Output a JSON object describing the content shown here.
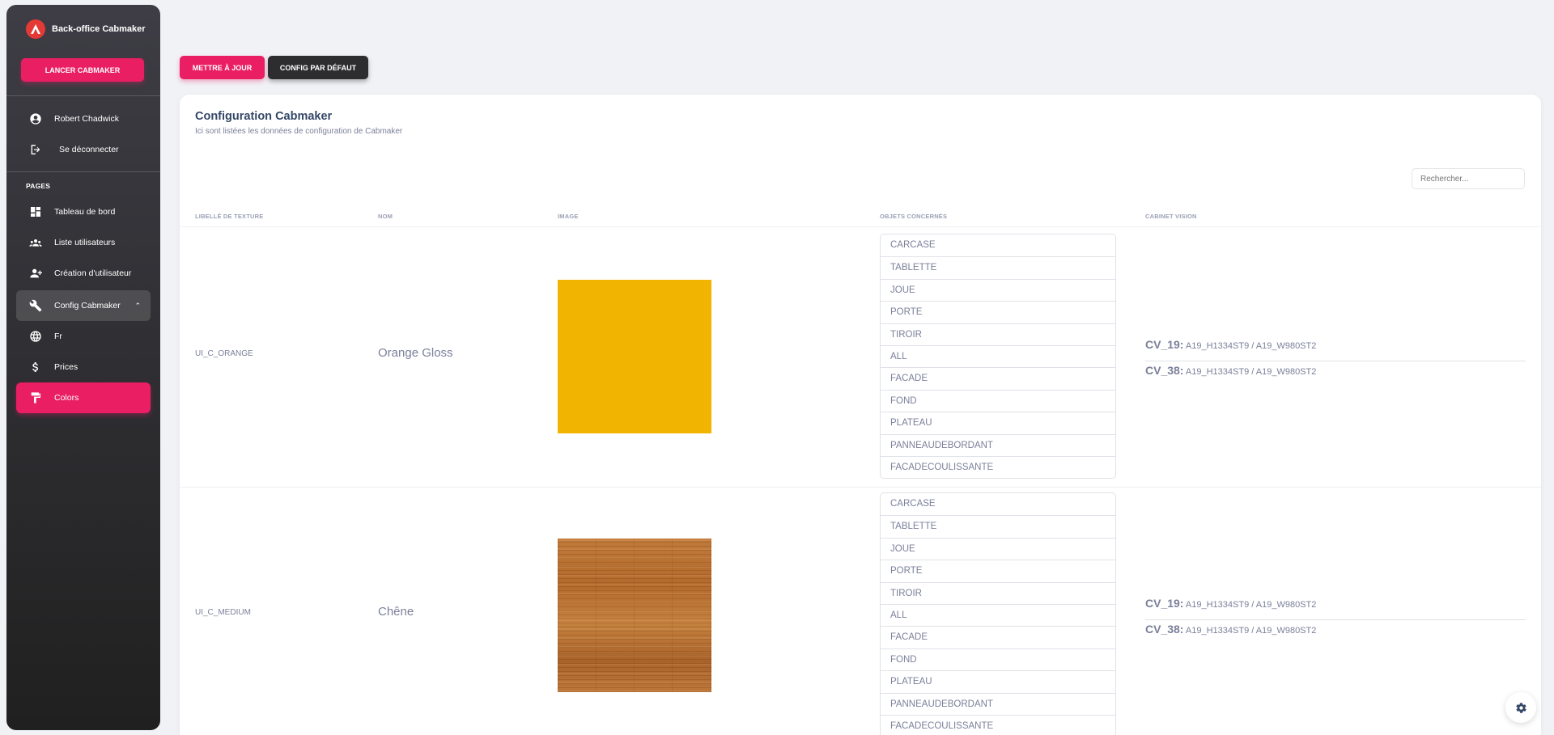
{
  "sidebar": {
    "brand": "Back-office Cabmaker",
    "launch_label": "LANCER CABMAKER",
    "user_name": "Robert Chadwick",
    "logout_label": "Se déconnecter",
    "section_label": "PAGES",
    "items": [
      {
        "label": "Tableau de bord"
      },
      {
        "label": "Liste utilisateurs"
      },
      {
        "label": "Création d'utilisateur"
      },
      {
        "label": "Config Cabmaker"
      },
      {
        "label": "Fr"
      },
      {
        "label": "Prices"
      },
      {
        "label": "Colors"
      }
    ]
  },
  "toolbar": {
    "update_label": "METTRE À JOUR",
    "default_label": "CONFIG PAR DÉFAUT"
  },
  "card": {
    "title": "Configuration Cabmaker",
    "subtitle": "Ici sont listées les données de configuration de Cabmaker",
    "search_placeholder": "Rechercher..."
  },
  "table": {
    "headers": [
      "LIBELLÉ DE TEXTURE",
      "NOM",
      "IMAGE",
      "OBJETS CONCERNÉS",
      "CABINET VISION"
    ],
    "rows": [
      {
        "label": "UI_C_ORANGE",
        "name": "Orange Gloss",
        "swatch_color": "#f1b400",
        "objects": [
          "CARCASE",
          "TABLETTE",
          "JOUE",
          "PORTE",
          "TIROIR",
          "ALL",
          "FACADE",
          "FOND",
          "PLATEAU",
          "PANNEAUDEBORDANT",
          "FACADECOULISSANTE"
        ],
        "cv": [
          {
            "key": "CV_19:",
            "value": "A19_H1334ST9 / A19_W980ST2"
          },
          {
            "key": "CV_38:",
            "value": "A19_H1334ST9 / A19_W980ST2"
          }
        ]
      },
      {
        "label": "UI_C_MEDIUM",
        "name": "Chêne",
        "swatch_color": "#b36a2c",
        "objects": [
          "CARCASE",
          "TABLETTE",
          "JOUE",
          "PORTE",
          "TIROIR",
          "ALL",
          "FACADE",
          "FOND",
          "PLATEAU",
          "PANNEAUDEBORDANT",
          "FACADECOULISSANTE"
        ],
        "cv": [
          {
            "key": "CV_19:",
            "value": "A19_H1334ST9 / A19_W980ST2"
          },
          {
            "key": "CV_38:",
            "value": "A19_H1334ST9 / A19_W980ST2"
          }
        ]
      }
    ]
  },
  "colors": {
    "accent": "#e91e63",
    "dark_button": "#2d2d30",
    "text": "#344767",
    "muted_text": "#7b809a"
  }
}
